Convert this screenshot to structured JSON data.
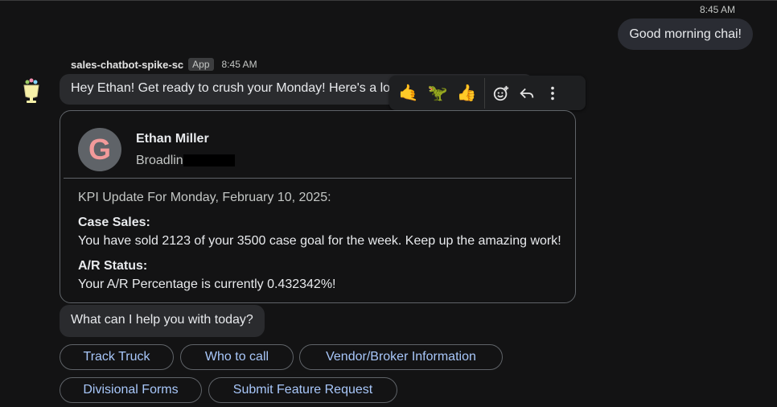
{
  "user_message": {
    "time": "8:45 AM",
    "text": "Good morning chai!"
  },
  "bot": {
    "name": "sales-chatbot-spike-sc",
    "badge": "App",
    "time": "8:45 AM",
    "greeting": "Hey Ethan! Get ready to crush your Monday!  Here's a look at your KPIs!"
  },
  "toolbar": {
    "reactions": [
      "🤙",
      "🦖",
      "👍"
    ],
    "actions": [
      "add-reaction-icon",
      "reply-icon",
      "more-vert-icon"
    ]
  },
  "card": {
    "title": "Ethan Miller",
    "subtitle": "Broadlin",
    "kpi_header": "KPI Update For Monday, February 10, 2025:",
    "case_sales_title": "Case Sales:",
    "case_sales_text": "You have sold 2123 of your 3500 case goal for the week. Keep up the amazing work!",
    "ar_title": "A/R Status:",
    "ar_text": "Your A/R Percentage is currently 0.432342%!"
  },
  "question": "What can I help you with today?",
  "chips": [
    "Track Truck",
    "Who to call",
    "Vendor/Broker Information",
    "Divisional Forms",
    "Submit Feature Request"
  ],
  "colors": {
    "background": "#131314",
    "chip_text": "#a8c7fa",
    "bubble": "#2a2b2e"
  }
}
